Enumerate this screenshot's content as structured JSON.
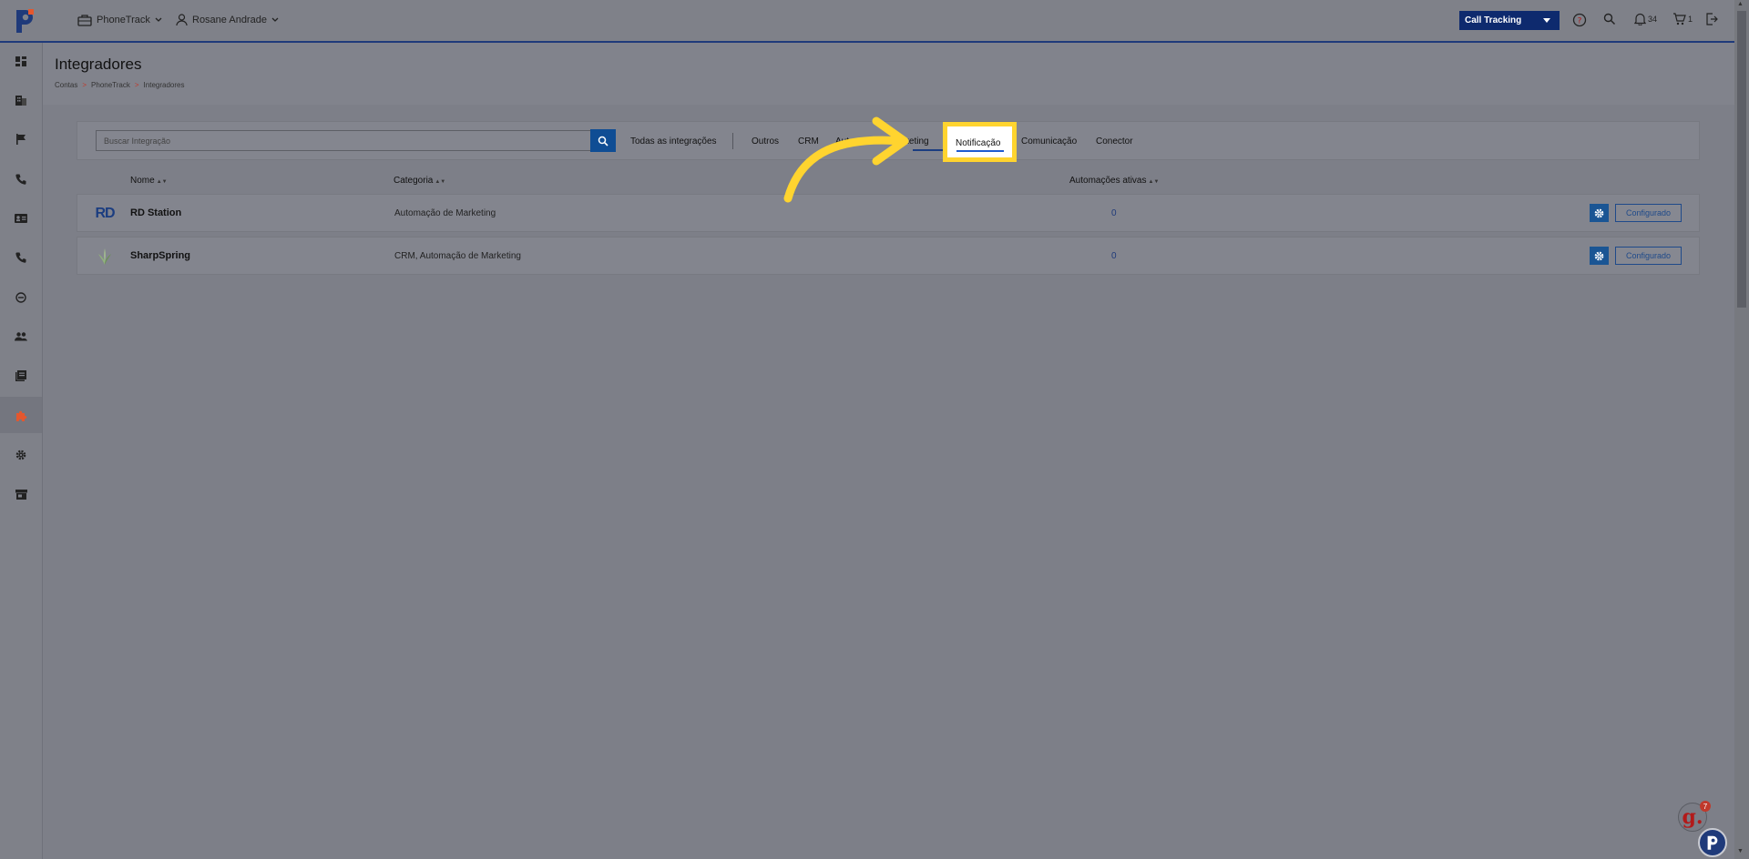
{
  "header": {
    "account_label": "PhoneTrack",
    "user_label": "Rosane Andrade",
    "product_button": "Call Tracking",
    "notifications_count": "34",
    "cart_count": "1"
  },
  "page": {
    "title": "Integradores",
    "breadcrumb": [
      "Contas",
      "PhoneTrack",
      "Integradores"
    ]
  },
  "search": {
    "placeholder": "Buscar Integração"
  },
  "tabs": {
    "all": "Todas as integrações",
    "outros": "Outros",
    "crm": "CRM",
    "automacao_visible_start": "Aut",
    "automacao_visible_end": "arketing",
    "notificacao": "Notificação",
    "comunicacao": "Comunicação",
    "conector": "Conector"
  },
  "table": {
    "columns": {
      "name": "Nome",
      "category": "Categoria",
      "automations": "Automações ativas"
    },
    "rows": [
      {
        "logo_text": "RD",
        "name": "RD Station",
        "category": "Automação de Marketing",
        "active": "0",
        "action": "Configurado"
      },
      {
        "logo_text": "",
        "name": "SharpSpring",
        "category": "CRM, Automação de Marketing",
        "active": "0",
        "action": "Configurado"
      }
    ]
  },
  "widgets": {
    "g_badge": "7",
    "g_letter": "g."
  },
  "sidebar": {
    "icons": [
      "dashboard-icon",
      "buildings-icon",
      "flag-icon",
      "phone-icon",
      "contact-card-icon",
      "phone-call-icon",
      "minus-circle-icon",
      "users-icon",
      "reports-icon",
      "puzzle-icon",
      "gear-icon",
      "store-icon"
    ]
  },
  "colors": {
    "brand_navy": "#0e2a6e",
    "accent_orange": "#e4572e",
    "highlight_yellow": "#ffd42f",
    "tab_active_blue": "#1f5bd0"
  }
}
